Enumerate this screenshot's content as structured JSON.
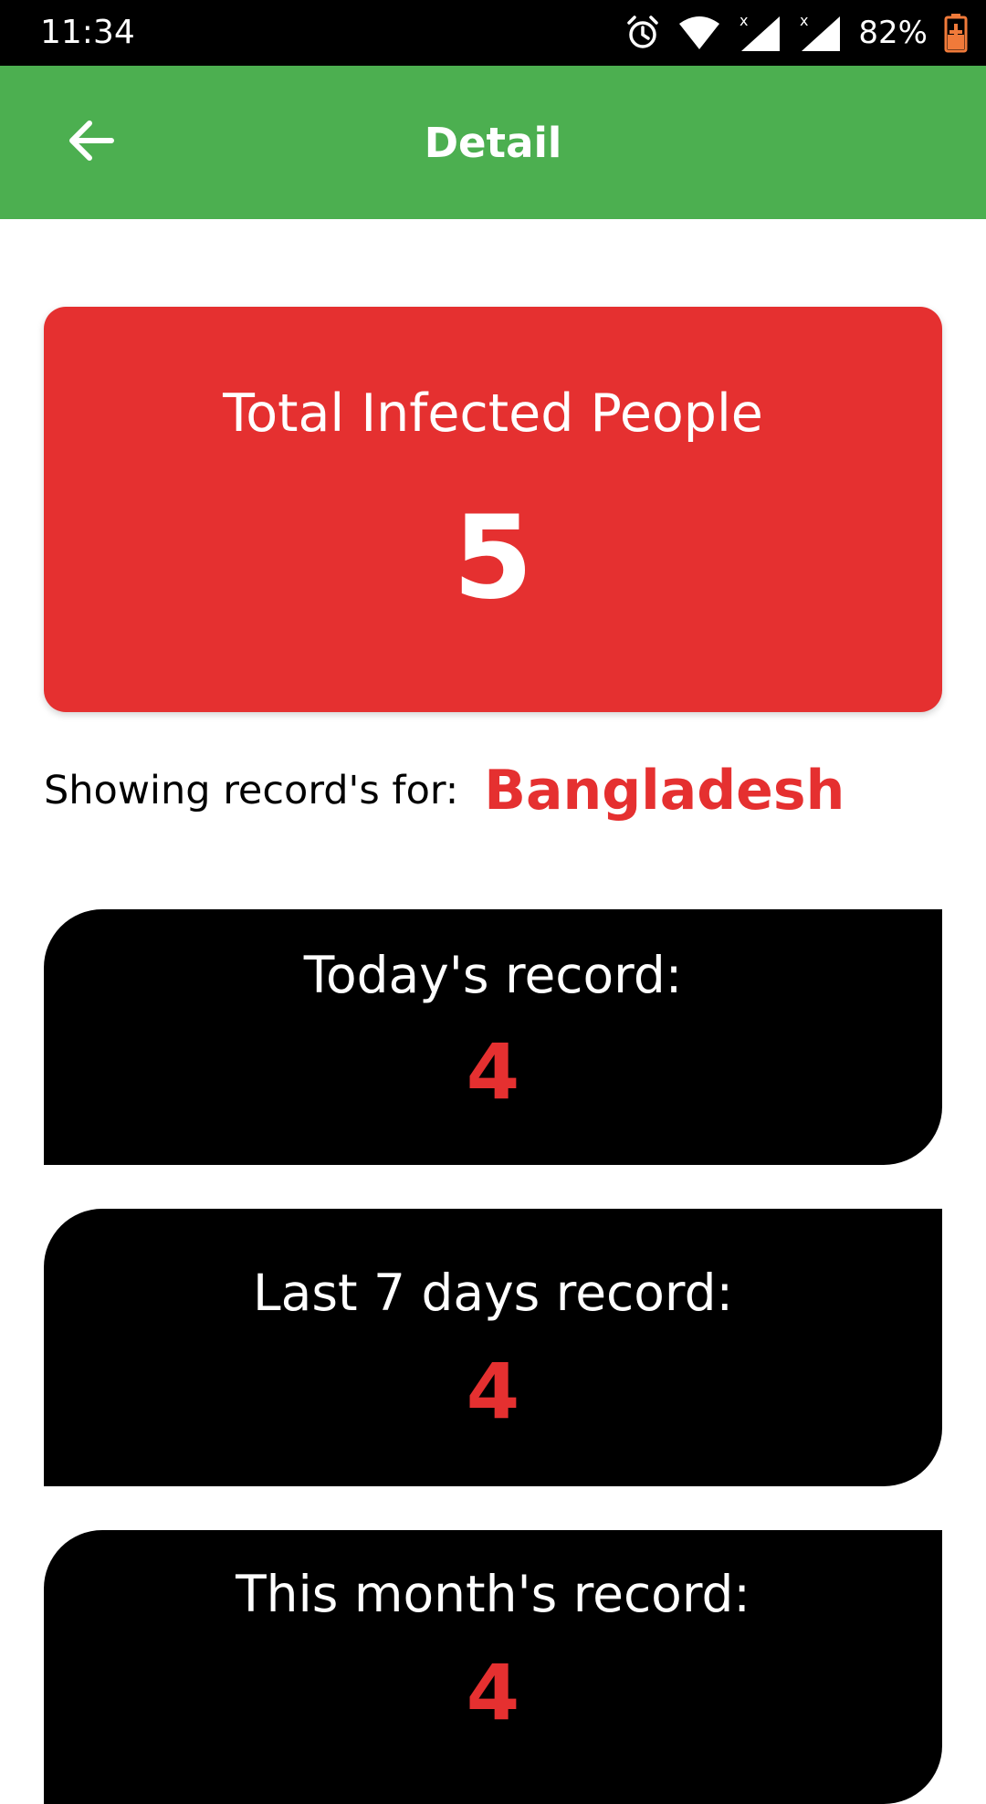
{
  "status_bar": {
    "time": "11:34",
    "battery": "82%",
    "icons": [
      "alarm-icon",
      "wifi-icon",
      "signal-icon",
      "signal-icon",
      "battery-charging-icon"
    ]
  },
  "app_bar": {
    "title": "Detail",
    "back_icon": "arrow-left-icon",
    "color": "#4caf50"
  },
  "total_card": {
    "label": "Total Infected People",
    "value": "5",
    "color": "#e53030"
  },
  "location": {
    "label": "Showing record's for:",
    "country": "Bangladesh"
  },
  "records": [
    {
      "label": "Today's record:",
      "value": "4"
    },
    {
      "label": "Last 7 days record:",
      "value": "4"
    },
    {
      "label": "This month's record:",
      "value": "4"
    }
  ]
}
